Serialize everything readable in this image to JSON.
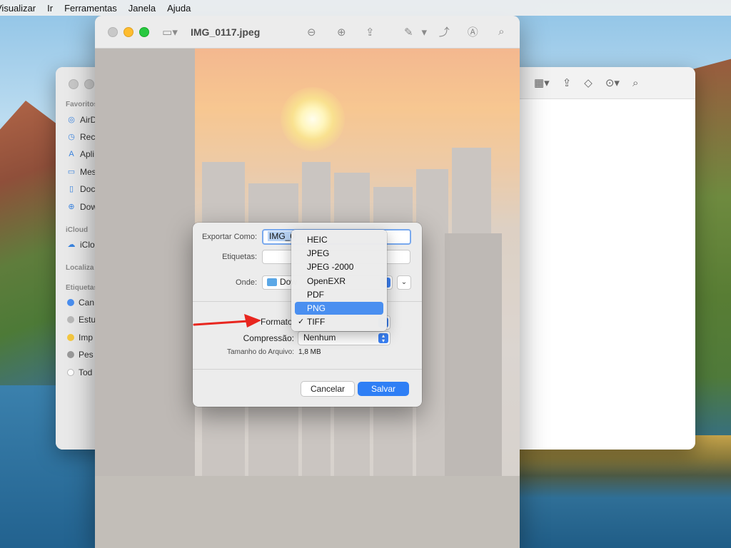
{
  "menubar": {
    "items": [
      "Visualizar",
      "Ir",
      "Ferramentas",
      "Janela",
      "Ajuda"
    ]
  },
  "finder": {
    "sections": {
      "favorites": "Favoritos",
      "icloud": "iCloud",
      "locations": "Localiza",
      "tags": "Etiquetas"
    },
    "favorites": [
      {
        "label": "AirD",
        "icon": "airdrop-icon"
      },
      {
        "label": "Rece",
        "icon": "recents-icon"
      },
      {
        "label": "Apli",
        "icon": "applications-icon"
      },
      {
        "label": "Mes",
        "icon": "desktop-icon"
      },
      {
        "label": "Doc",
        "icon": "documents-icon"
      },
      {
        "label": "Dow",
        "icon": "downloads-icon"
      }
    ],
    "icloud_items": [
      {
        "label": "iClo",
        "icon": "icloud-icon"
      }
    ],
    "tags": [
      {
        "label": "Can",
        "color": "#4a8ff0"
      },
      {
        "label": "Estu",
        "color": "#b9b9b9"
      },
      {
        "label": "Imp",
        "color": "#f5c840"
      },
      {
        "label": "Pes",
        "color": "#9a9a9a"
      },
      {
        "label": "Tod",
        "color": "#cfcfcf"
      }
    ]
  },
  "preview": {
    "title": "IMG_0117.jpeg"
  },
  "export_sheet": {
    "export_as_label": "Exportar Como:",
    "filename": "IMG_0",
    "tags_label": "Etiquetas:",
    "tags_value": "",
    "where_label": "Onde:",
    "where_value": "Dow",
    "format_label": "Formato",
    "compression_label": "Compressão:",
    "compression_value": "Nenhum",
    "filesize_label": "Tamanho do Arquivo:",
    "filesize_value": "1,8 MB",
    "cancel_label": "Cancelar",
    "save_label": "Salvar"
  },
  "format_menu": {
    "options": [
      "HEIC",
      "JPEG",
      "JPEG -2000",
      "OpenEXR",
      "PDF",
      "PNG",
      "TIFF"
    ],
    "highlighted": "PNG",
    "checked": "TIFF",
    "check_glyph": "✓"
  },
  "colors": {
    "accent": "#2f7ff5",
    "highlight": "#4a8ff0",
    "arrow": "#e8261f"
  }
}
